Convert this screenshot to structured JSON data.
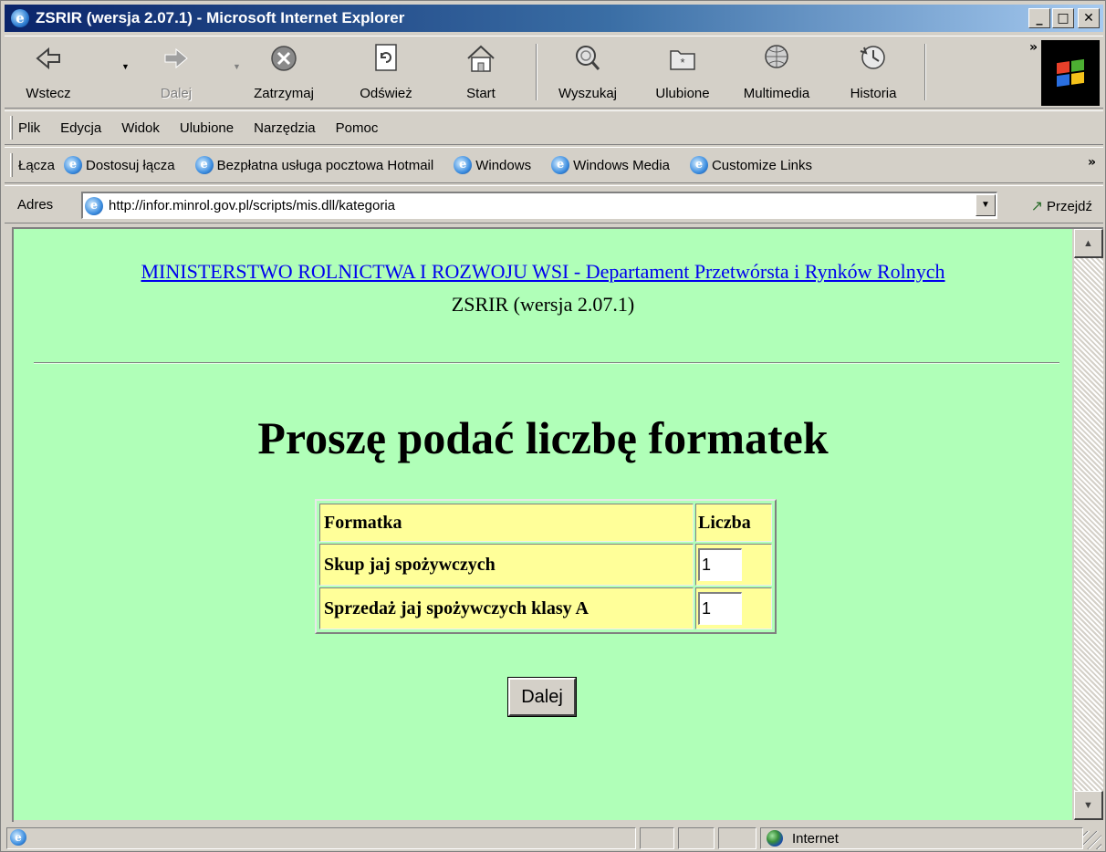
{
  "window": {
    "title": "ZSRIR (wersja 2.07.1) - Microsoft Internet Explorer",
    "controls": {
      "minimize": "_",
      "maximize": "□",
      "close": "✕"
    }
  },
  "toolbar": {
    "buttons": [
      {
        "label": "Wstecz",
        "icon": "back-arrow-icon",
        "enabled": true
      },
      {
        "label": "Dalej",
        "icon": "forward-arrow-icon",
        "enabled": false
      },
      {
        "label": "Zatrzymaj",
        "icon": "stop-icon",
        "enabled": true
      },
      {
        "label": "Odśwież",
        "icon": "refresh-icon",
        "enabled": true
      },
      {
        "label": "Start",
        "icon": "home-icon",
        "enabled": true
      },
      {
        "label": "Wyszukaj",
        "icon": "search-icon",
        "enabled": true
      },
      {
        "label": "Ulubione",
        "icon": "favorites-icon",
        "enabled": true
      },
      {
        "label": "Multimedia",
        "icon": "media-icon",
        "enabled": true
      },
      {
        "label": "Historia",
        "icon": "history-icon",
        "enabled": true
      }
    ],
    "chevron": "»"
  },
  "menu": {
    "items": [
      "Plik",
      "Edycja",
      "Widok",
      "Ulubione",
      "Narzędzia",
      "Pomoc"
    ]
  },
  "links_bar": {
    "label": "Łącza",
    "items": [
      "Dostosuj łącza",
      "Bezpłatna usługa pocztowa Hotmail",
      "Windows",
      "Windows Media",
      "Customize Links"
    ],
    "chevron": "»"
  },
  "address_bar": {
    "label": "Adres",
    "url": "http://infor.minrol.gov.pl/scripts/mis.dll/kategoria",
    "go_label": "Przejdź"
  },
  "page": {
    "ministry_link": "MINISTERSTWO ROLNICTWA I ROZWOJU WSI - Departament Przetwórsta i Rynków Rolnych",
    "version": "ZSRIR (wersja 2.07.1)",
    "heading": "Proszę podać liczbę formatek",
    "table": {
      "headers": [
        "Formatka",
        "Liczba"
      ],
      "rows": [
        {
          "name": "Skup jaj spożywczych",
          "value": "1"
        },
        {
          "name": "Sprzedaż jaj spożywczych klasy A",
          "value": "1"
        }
      ]
    },
    "submit_label": "Dalej",
    "background_color": "#b0ffb8",
    "cell_color": "#ffff99",
    "link_color": "#0000ee"
  },
  "status_bar": {
    "zone": "Internet"
  }
}
